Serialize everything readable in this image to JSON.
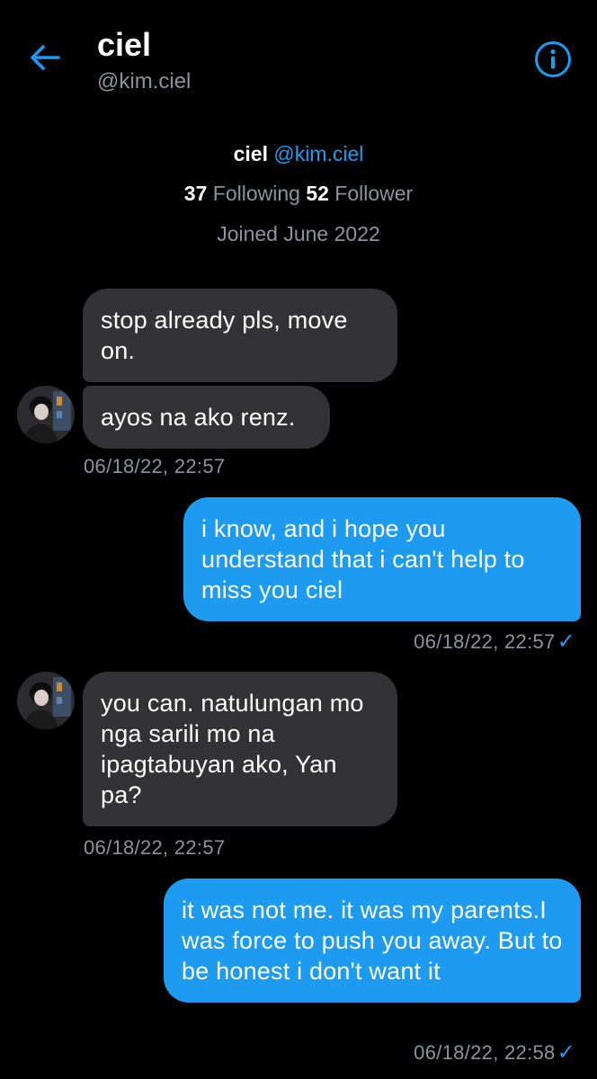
{
  "header": {
    "name": "ciel",
    "handle": "@kim.ciel",
    "back_icon": "arrow-left-icon",
    "info_icon": "info-icon",
    "accent_color": "#1d9bf0"
  },
  "profile": {
    "name": "ciel",
    "handle": "@kim.ciel",
    "following_count": "37",
    "following_label": "Following",
    "follower_count": "52",
    "follower_label": "Follower",
    "joined": "Joined June 2022"
  },
  "messages": [
    {
      "direction": "incoming",
      "text": "stop already pls, move on."
    },
    {
      "direction": "incoming",
      "text": "ayos na ako renz.",
      "timestamp": "06/18/22, 22:57"
    },
    {
      "direction": "outgoing",
      "text": "i know, and i hope you understand that i can't help to miss you ciel",
      "timestamp": "06/18/22, 22:57",
      "read_icon": "checkmark-icon"
    },
    {
      "direction": "incoming",
      "text": "you can. natulungan mo nga sarili mo na ipagtabuyan ako, Yan pa?",
      "timestamp": "06/18/22, 22:57"
    },
    {
      "direction": "outgoing",
      "text": "it was not me. it was my parents.I was force to push you away. But to be honest i don't want it",
      "timestamp": "06/18/22, 22:58",
      "read_icon": "checkmark-icon"
    }
  ],
  "colors": {
    "background": "#000000",
    "incoming_bubble": "#333336",
    "outgoing_bubble": "#1d9bf0",
    "muted_text": "#8b949e"
  }
}
